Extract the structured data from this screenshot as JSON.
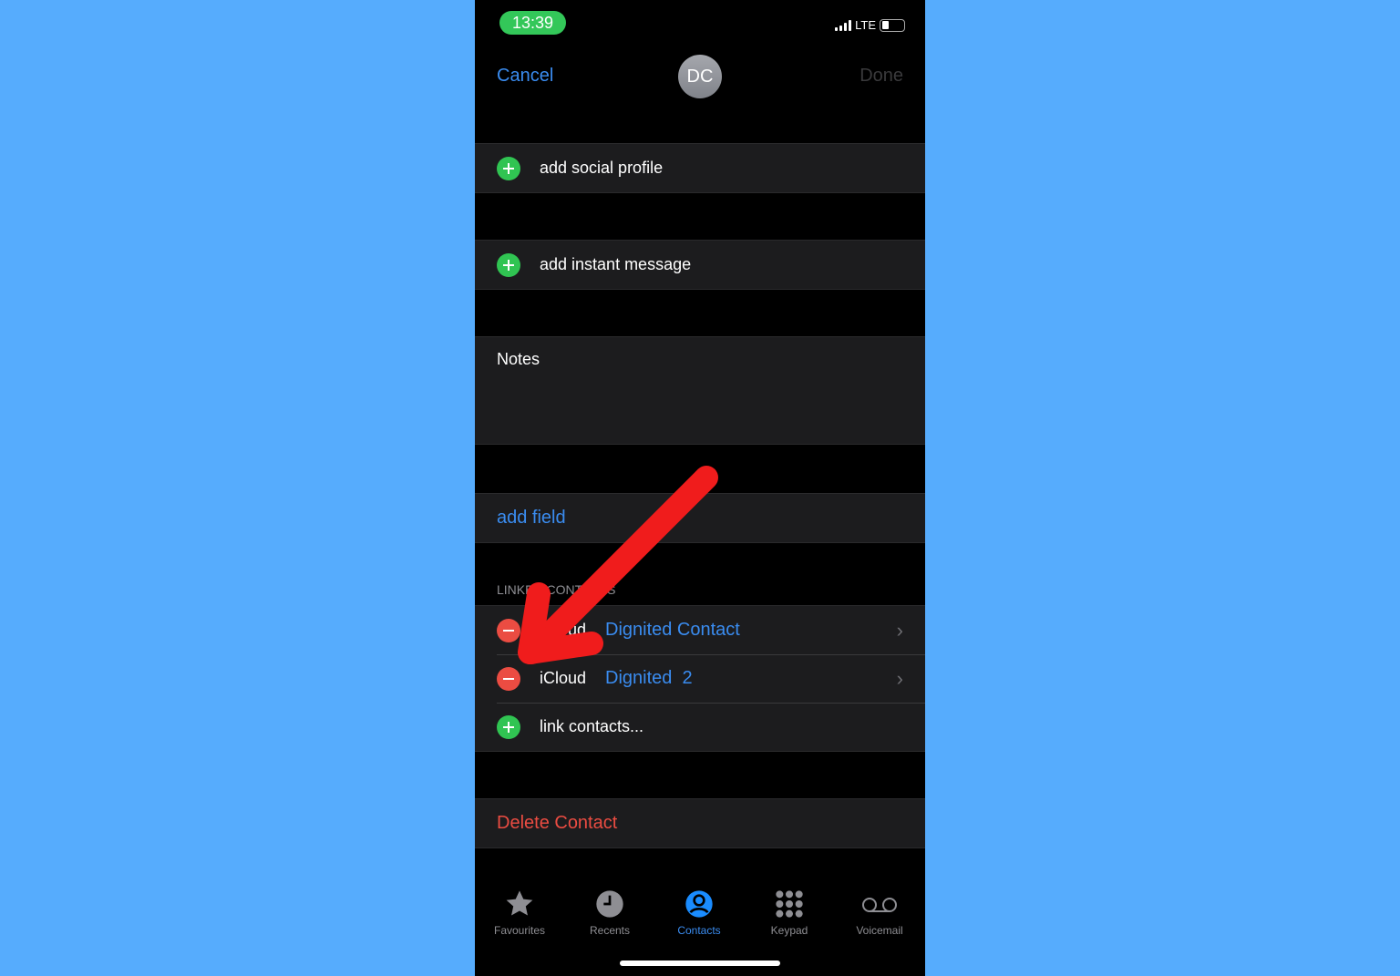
{
  "status": {
    "time": "13:39",
    "network": "LTE"
  },
  "nav": {
    "cancel": "Cancel",
    "avatar_initials": "DC",
    "done": "Done"
  },
  "rows": {
    "social": "add social profile",
    "im": "add instant message",
    "notes": "Notes",
    "add_field": "add field"
  },
  "linked": {
    "header": "LINKED CONTACTS",
    "items": [
      {
        "source": "iCloud",
        "name": "Dignited Contact"
      },
      {
        "source": "iCloud",
        "name": "Dignited  2"
      }
    ],
    "link": "link contacts..."
  },
  "delete": "Delete Contact",
  "tabs": [
    {
      "label": "Favourites",
      "icon": "star-icon"
    },
    {
      "label": "Recents",
      "icon": "clock-icon"
    },
    {
      "label": "Contacts",
      "icon": "person-circle-icon",
      "active": true
    },
    {
      "label": "Keypad",
      "icon": "keypad-icon"
    },
    {
      "label": "Voicemail",
      "icon": "voicemail-icon"
    }
  ],
  "colors": {
    "accent": "#3a8cf0",
    "destructive": "#eb4c42",
    "add": "#30c452",
    "arrow": "#f01c1c",
    "background": "#56acfd"
  }
}
